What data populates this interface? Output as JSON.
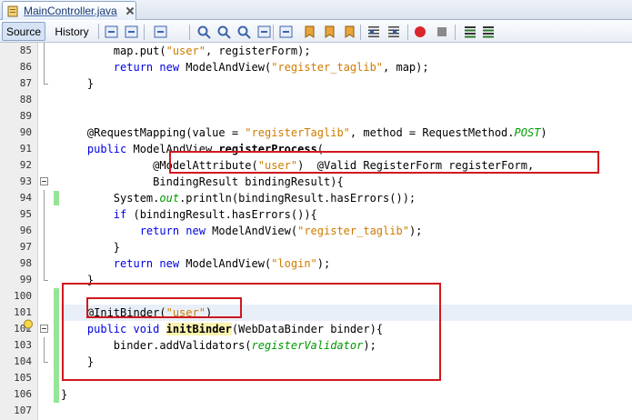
{
  "tab": {
    "title": "MainController.java"
  },
  "toolbar": {
    "source_label": "Source",
    "history_label": "History",
    "buttons": [
      "last-edit-icon",
      "back-icon",
      "forward-icon",
      "find-selection-icon",
      "find-previous-icon",
      "find-next-icon",
      "toggle-highlight-icon",
      "toggle-rect-selection-icon",
      "previous-bookmark-icon",
      "next-bookmark-icon",
      "toggle-bookmark-icon",
      "shift-left-icon",
      "shift-right-icon",
      "start-macro-icon",
      "stop-macro-icon",
      "comment-icon",
      "uncomment-icon"
    ]
  },
  "lines": [
    {
      "num": "85",
      "indent": "        ",
      "tokens": [
        [
          "t",
          "map.put("
        ],
        [
          "s",
          "\"user\""
        ],
        [
          "t",
          ", registerForm);"
        ]
      ]
    },
    {
      "num": "86",
      "indent": "        ",
      "tokens": [
        [
          "k",
          "return new"
        ],
        [
          "t",
          " ModelAndView("
        ],
        [
          "s",
          "\"register_taglib\""
        ],
        [
          "t",
          ", map);"
        ]
      ]
    },
    {
      "num": "87",
      "indent": "    ",
      "tokens": [
        [
          "t",
          "}"
        ]
      ]
    },
    {
      "num": "88",
      "indent": "",
      "tokens": []
    },
    {
      "num": "89",
      "indent": "",
      "tokens": []
    },
    {
      "num": "90",
      "indent": "    ",
      "tokens": [
        [
          "t",
          "@RequestMapping(value = "
        ],
        [
          "s",
          "\"registerTaglib\""
        ],
        [
          "t",
          ", method = RequestMethod."
        ],
        [
          "c",
          "POST"
        ],
        [
          "t",
          ")"
        ]
      ]
    },
    {
      "num": "91",
      "indent": "    ",
      "tokens": [
        [
          "k",
          "public"
        ],
        [
          "t",
          " ModelAndView "
        ],
        [
          "b",
          "registerProcess"
        ],
        [
          "t",
          "("
        ]
      ]
    },
    {
      "num": "92",
      "indent": "              ",
      "tokens": [
        [
          "t",
          "@ModelAttribute("
        ],
        [
          "s",
          "\"user\""
        ],
        [
          "t",
          ")  @Valid RegisterForm registerForm,"
        ]
      ]
    },
    {
      "num": "93",
      "indent": "              ",
      "tokens": [
        [
          "t",
          "BindingResult bindingResult){"
        ]
      ]
    },
    {
      "num": "94",
      "indent": "        ",
      "tokens": [
        [
          "t",
          "System."
        ],
        [
          "f",
          "out"
        ],
        [
          "t",
          ".println(bindingResult.hasErrors());"
        ]
      ]
    },
    {
      "num": "95",
      "indent": "        ",
      "tokens": [
        [
          "k",
          "if"
        ],
        [
          "t",
          " (bindingResult.hasErrors()){"
        ]
      ]
    },
    {
      "num": "96",
      "indent": "            ",
      "tokens": [
        [
          "k",
          "return new"
        ],
        [
          "t",
          " ModelAndView("
        ],
        [
          "s",
          "\"register_taglib\""
        ],
        [
          "t",
          ");"
        ]
      ]
    },
    {
      "num": "97",
      "indent": "        ",
      "tokens": [
        [
          "t",
          "}"
        ]
      ]
    },
    {
      "num": "98",
      "indent": "        ",
      "tokens": [
        [
          "k",
          "return new"
        ],
        [
          "t",
          " ModelAndView("
        ],
        [
          "s",
          "\"login\""
        ],
        [
          "t",
          ");"
        ]
      ]
    },
    {
      "num": "99",
      "indent": "    ",
      "tokens": [
        [
          "t",
          "}"
        ]
      ]
    },
    {
      "num": "100",
      "indent": "",
      "tokens": []
    },
    {
      "num": "101",
      "indent": "    ",
      "tokens": [
        [
          "t",
          "@InitBinder("
        ],
        [
          "s",
          "\"user\""
        ],
        [
          "t",
          ")"
        ]
      ]
    },
    {
      "num": "102",
      "indent": "    ",
      "tokens": [
        [
          "k",
          "public void"
        ],
        [
          "t",
          " "
        ],
        [
          "h",
          "initBinder"
        ],
        [
          "t",
          "(WebDataBinder binder){"
        ]
      ]
    },
    {
      "num": "103",
      "indent": "        ",
      "tokens": [
        [
          "t",
          "binder.addValidators("
        ],
        [
          "f",
          "registerValidator"
        ],
        [
          "t",
          ");"
        ]
      ]
    },
    {
      "num": "104",
      "indent": "    ",
      "tokens": [
        [
          "t",
          "}"
        ]
      ]
    },
    {
      "num": "105",
      "indent": "",
      "tokens": []
    },
    {
      "num": "106",
      "indent": "",
      "tokens": [
        [
          "t",
          "}"
        ]
      ]
    },
    {
      "num": "107",
      "indent": "",
      "tokens": []
    }
  ],
  "current_line": "101",
  "colors": {
    "keyword": "#0000e6",
    "string": "#ce7b00",
    "field": "#009900",
    "annotation_box": "#d0181f",
    "changed_marker": "#96e596"
  }
}
